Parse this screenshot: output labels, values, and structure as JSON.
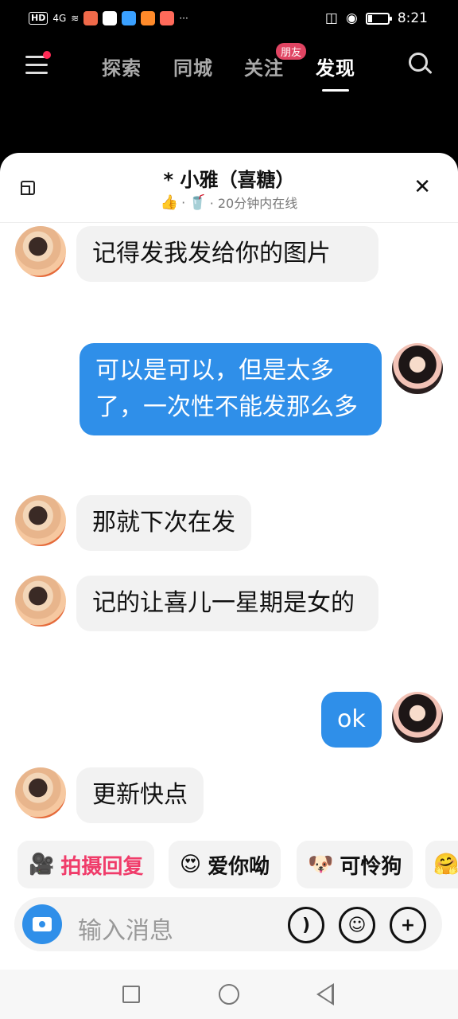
{
  "status_bar": {
    "left_text": "HD",
    "network": "4G",
    "more": "···",
    "time": "8:21"
  },
  "top_nav": {
    "tabs": [
      {
        "label": "探索"
      },
      {
        "label": "同城"
      },
      {
        "label": "关注"
      },
      {
        "label": "发现"
      }
    ],
    "follow_badge": "朋友",
    "active_tab": "发现"
  },
  "chat": {
    "title": "* 小雅（喜糖）",
    "subtitle_sep": "·",
    "online_status": "· 20分钟内在线",
    "messages": [
      {
        "side": "left",
        "text": "记得发我发给你的图片"
      },
      {
        "side": "right",
        "text": "可以是可以，但是太多了，一次性不能发那么多"
      },
      {
        "side": "left",
        "text": "那就下次在发"
      },
      {
        "side": "left",
        "text": "记的让喜儿一星期是女的"
      },
      {
        "side": "right",
        "text": "ok"
      },
      {
        "side": "left",
        "text": "更新快点"
      }
    ]
  },
  "quick_replies": [
    {
      "label": "拍摄回复",
      "icon": "camera-sticker-icon",
      "emoji": "🎥"
    },
    {
      "label": "爱你呦",
      "icon": "heart-eyes-emoji-icon",
      "emoji": "😍"
    },
    {
      "label": "可怜狗",
      "icon": "puppy-emoji-icon",
      "emoji": "🐶"
    },
    {
      "label": "",
      "icon": "hugging-emoji-icon",
      "emoji": "🤗"
    }
  ],
  "input": {
    "placeholder": "输入消息"
  },
  "colors": {
    "accent": "#2f8fe9",
    "badge": "#e04462",
    "pink": "#f03c6a"
  }
}
